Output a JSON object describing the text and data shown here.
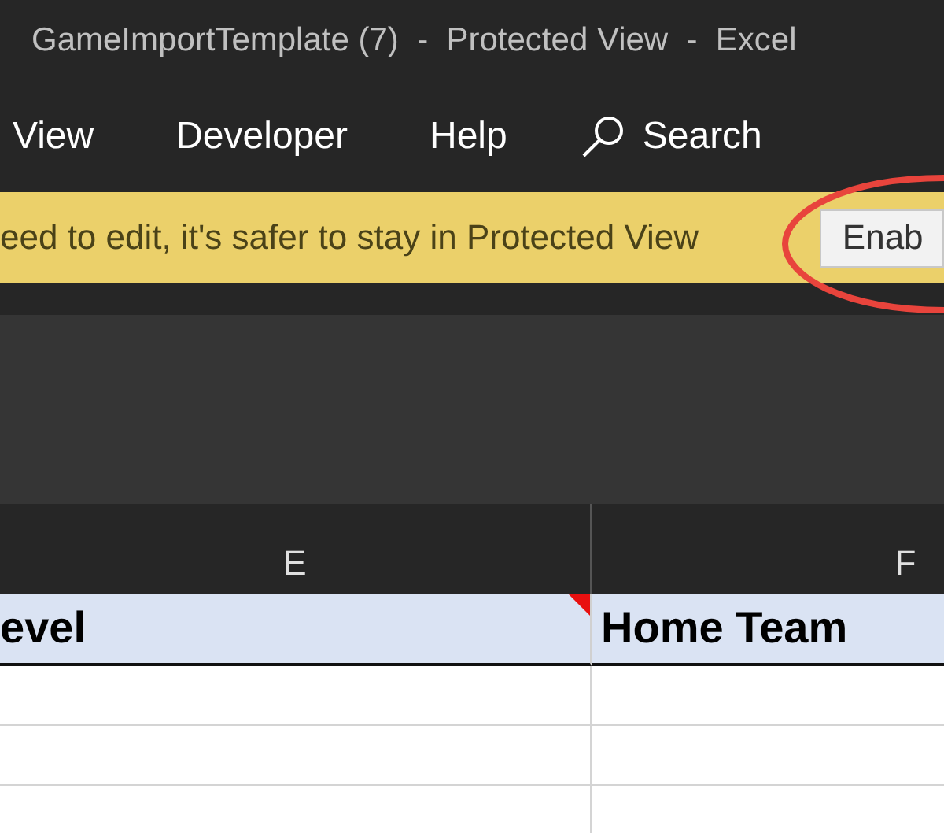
{
  "window": {
    "title": "GameImportTemplate (7)  -  Protected View  -  Excel"
  },
  "ribbon_tabs": [
    {
      "label": "View"
    },
    {
      "label": "Developer"
    },
    {
      "label": "Help"
    }
  ],
  "search": {
    "label": "Search"
  },
  "message_bar": {
    "text": "eed to edit, it's safer to stay in Protected View",
    "button": "Enab",
    "highlighted": true
  },
  "columns": [
    {
      "letter": "E"
    },
    {
      "letter": "F"
    }
  ],
  "header_row": [
    {
      "text": "evel",
      "comment": true
    },
    {
      "text": "Home Team"
    }
  ]
}
